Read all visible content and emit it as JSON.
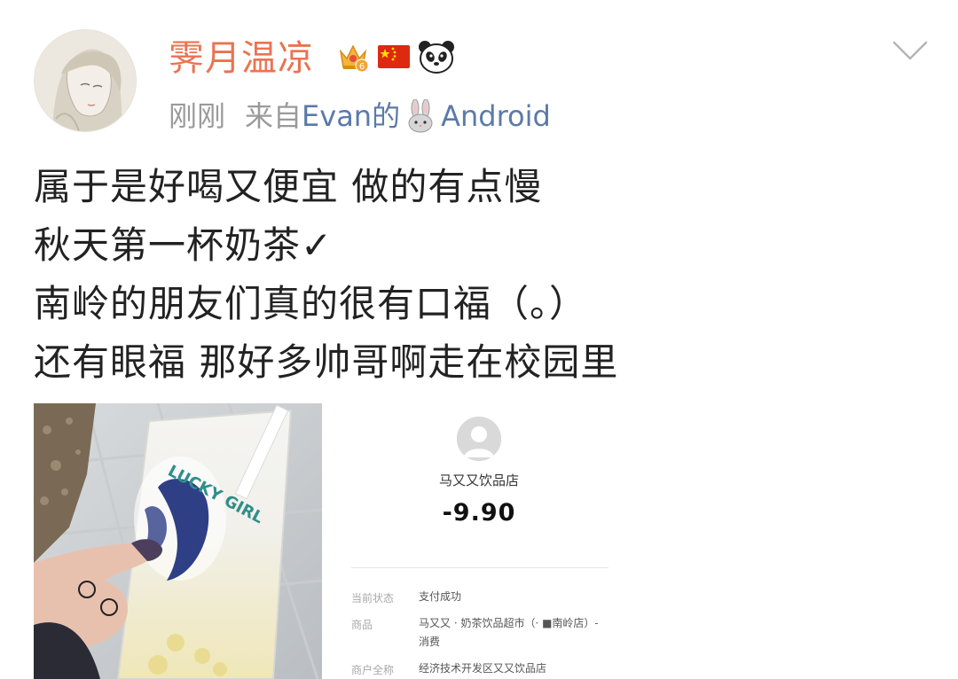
{
  "post": {
    "username": "霁月温凉",
    "time": "刚刚",
    "source_prefix": "来自",
    "source_name": "Evan的",
    "source_suffix": "Android",
    "badges": [
      "vip-crown-icon",
      "china-flag-icon",
      "panda-icon"
    ],
    "lines": [
      "属于是好喝又便宜 做的有点慢",
      "秋天第一杯奶茶✓",
      "南岭的朋友们真的很有口福（。）",
      "还有眼福 那好多帅哥啊走在校园里"
    ]
  },
  "photo": {
    "cup_text": "LUCKY GIRL"
  },
  "receipt": {
    "merchant": "马又又饮品店",
    "amount": "-9.90",
    "rows": [
      {
        "label": "当前状态",
        "value": "支付成功"
      },
      {
        "label": "商品",
        "value": "马又又 · 奶茶饮品超市（·   ■南岭店）-消费"
      },
      {
        "label": "商户全称",
        "value": "经济技术开发区又又饮品店"
      }
    ]
  },
  "colors": {
    "username": "#eb7350",
    "link": "#5b7aa8",
    "meta": "#9a9a9a",
    "text": "#222222"
  }
}
